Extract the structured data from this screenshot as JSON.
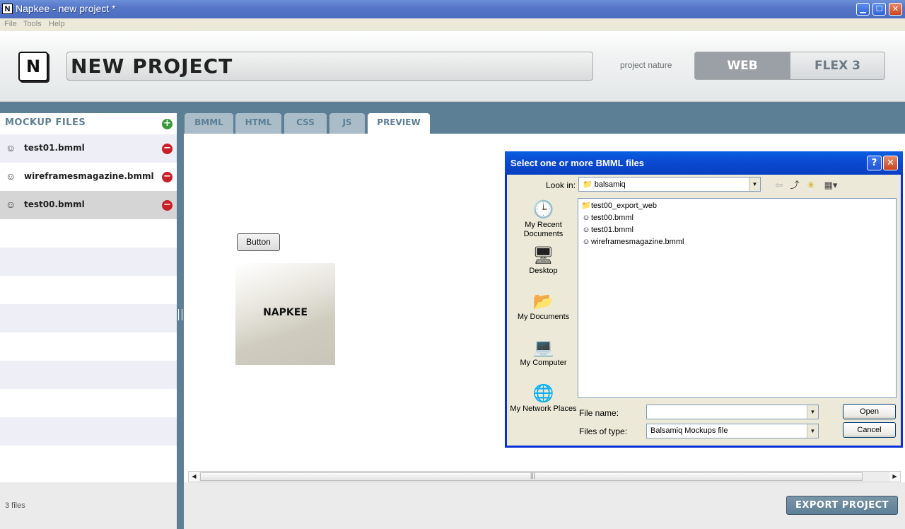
{
  "window": {
    "title": "Napkee - new project *",
    "app_icon": "N",
    "min_icon": "▁",
    "max_icon": "☐",
    "close_icon": "✕"
  },
  "menu": [
    "File",
    "Tools",
    "Help"
  ],
  "header": {
    "logo": "N",
    "project_name": "NEW PROJECT",
    "nature_label": "project nature",
    "nature_options": [
      "WEB",
      "FLEX 3"
    ],
    "nature_selected": "WEB"
  },
  "sidebar": {
    "title": "MOCKUP FILES",
    "add_icon": "+",
    "remove_icon": "−",
    "file_icon": "☺",
    "files": [
      "test01.bmml",
      "wireframesmagazine.bmml",
      "test00.bmml"
    ],
    "selected": "test00.bmml",
    "count_label": "3 files"
  },
  "tabs": [
    "BMML",
    "HTML",
    "CSS",
    "JS",
    "PREVIEW"
  ],
  "active_tab": "PREVIEW",
  "preview": {
    "button_label": "Button",
    "image_label": "NAPKEE"
  },
  "export_label": "EXPORT PROJECT",
  "dialog": {
    "title": "Select one or more BMML files",
    "help_icon": "?",
    "close_icon": "✕",
    "look_in_label": "Look in:",
    "look_in_value": "balsamiq",
    "toolbar_icons": [
      "back-icon",
      "up-folder-icon",
      "new-folder-icon",
      "view-menu-icon"
    ],
    "places": [
      {
        "label": "My Recent Documents",
        "icon": "recent-documents-icon"
      },
      {
        "label": "Desktop",
        "icon": "desktop-icon"
      },
      {
        "label": "My Documents",
        "icon": "my-documents-icon"
      },
      {
        "label": "My Computer",
        "icon": "my-computer-icon"
      },
      {
        "label": "My Network Places",
        "icon": "network-places-icon"
      }
    ],
    "files": [
      {
        "name": "test00_export_web",
        "type": "folder"
      },
      {
        "name": "test00.bmml",
        "type": "file"
      },
      {
        "name": "test01.bmml",
        "type": "file"
      },
      {
        "name": "wireframesmagazine.bmml",
        "type": "file"
      }
    ],
    "file_name_label": "File name:",
    "file_name_value": "",
    "file_type_label": "Files of type:",
    "file_type_value": "Balsamiq Mockups file",
    "open_label": "Open",
    "cancel_label": "Cancel"
  }
}
